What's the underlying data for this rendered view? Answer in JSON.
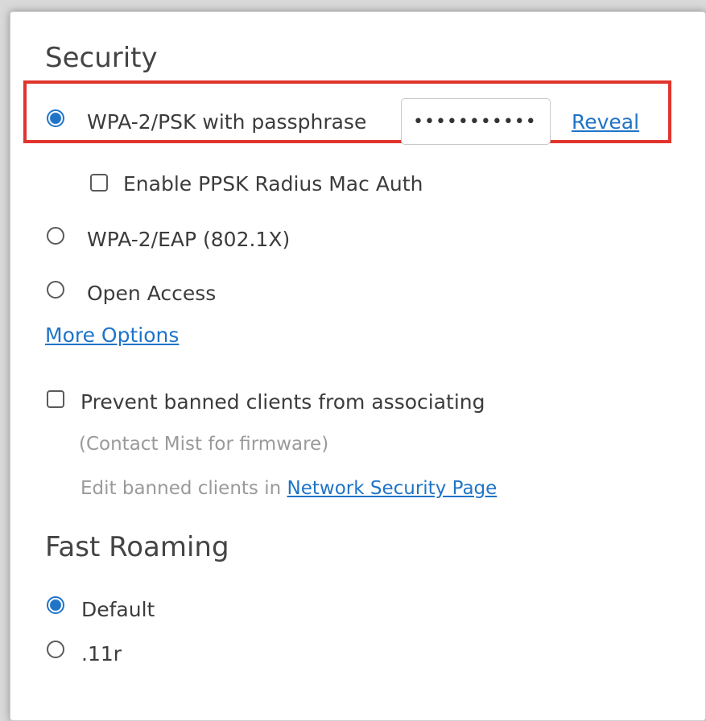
{
  "security": {
    "title": "Security",
    "wpa2_psk": {
      "label": "WPA-2/PSK with passphrase",
      "checked": true
    },
    "passphrase": {
      "value": "••••••••••••",
      "type": "password"
    },
    "reveal_label": "Reveal",
    "ppsk": {
      "label": "Enable PPSK Radius Mac Auth",
      "checked": false
    },
    "wpa2_eap": {
      "label": "WPA-2/EAP (802.1X)",
      "checked": false
    },
    "open_access": {
      "label": "Open Access",
      "checked": false
    },
    "more_options_label": "More Options",
    "prevent_banned": {
      "label": "Prevent banned clients from associating",
      "checked": false
    },
    "firmware_note": "(Contact Mist for firmware)",
    "edit_banned_text": "Edit banned clients in",
    "network_security_link": "Network Security Page"
  },
  "fast_roaming": {
    "title": "Fast Roaming",
    "default": {
      "label": "Default",
      "checked": true
    },
    "dot11r": {
      "label": ".11r",
      "checked": false
    }
  },
  "colors": {
    "accent": "#1f74c7",
    "highlight": "#e0342d"
  }
}
